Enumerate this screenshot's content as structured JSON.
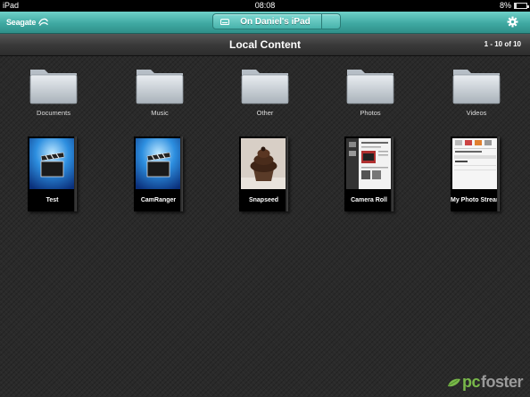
{
  "status_bar": {
    "device": "iPad",
    "time": "08:08",
    "battery": "8%",
    "battery_level": 0.08
  },
  "nav": {
    "brand": "Seagate",
    "location": "On Daniel's iPad",
    "settings_icon": "gear-icon"
  },
  "header": {
    "title": "Local Content",
    "count": "1 - 10 of 10"
  },
  "folders": [
    {
      "label": "Documents",
      "icon": "folder-icon"
    },
    {
      "label": "Music",
      "icon": "folder-icon"
    },
    {
      "label": "Other",
      "icon": "folder-icon"
    },
    {
      "label": "Photos",
      "icon": "folder-icon"
    },
    {
      "label": "Videos",
      "icon": "folder-icon"
    }
  ],
  "albums": [
    {
      "label": "Test",
      "thumbnail": "video-clapper-thumbnail"
    },
    {
      "label": "CamRanger",
      "thumbnail": "video-clapper-thumbnail"
    },
    {
      "label": "Snapseed",
      "thumbnail": "cupcake-photo-thumbnail"
    },
    {
      "label": "Camera Roll",
      "thumbnail": "camera-screenshot-thumbnail"
    },
    {
      "label": "My Photo Stream",
      "thumbnail": "app-screenshot-thumbnail"
    }
  ],
  "watermark": {
    "part1": "pc",
    "part2": "foster"
  },
  "colors": {
    "nav_teal": "#3fa9a2",
    "background": "#2a2a2a",
    "watermark_green": "#79b84a"
  }
}
